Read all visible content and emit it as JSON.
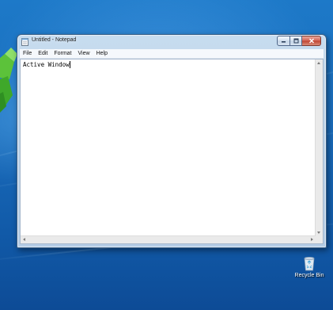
{
  "window": {
    "title": "Untitled - Notepad",
    "app_icon": "notepad-icon",
    "controls": [
      "minimize-icon",
      "maximize-icon",
      "close-icon"
    ]
  },
  "menu": {
    "file": "File",
    "edit": "Edit",
    "format": "Format",
    "view": "View",
    "help": "Help"
  },
  "editor": {
    "text": "Active Window"
  },
  "desktop": {
    "recycle_bin_label": "Recycle Bin",
    "recycle_bin_icon": "recycle-bin-icon"
  },
  "colors": {
    "desktop_top": "#1d79c8",
    "desktop_bottom": "#0d4b96",
    "window_frame": "#c7dcef",
    "close_button": "#c14735"
  }
}
